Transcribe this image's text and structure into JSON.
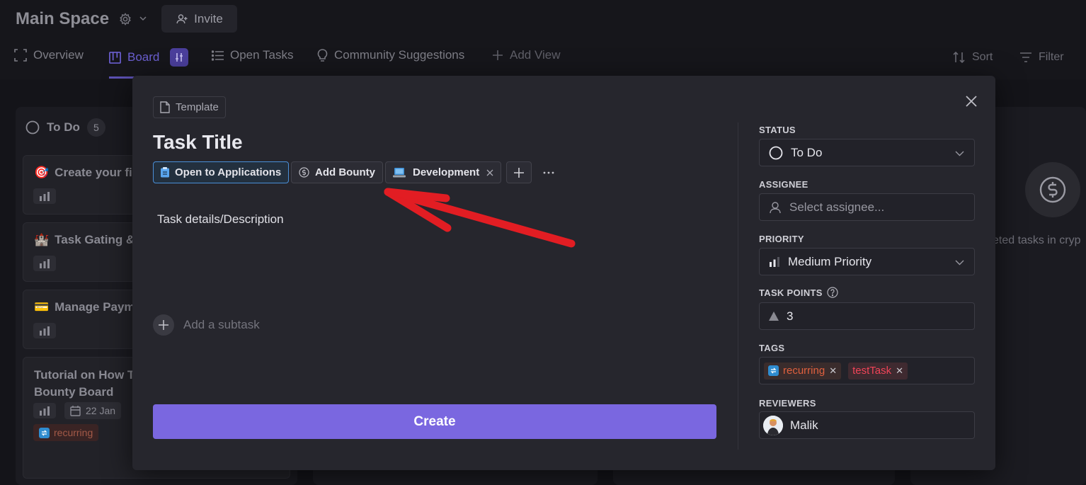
{
  "header": {
    "space_title": "Main Space",
    "invite_label": "Invite"
  },
  "tabs": [
    {
      "label": "Overview"
    },
    {
      "label": "Board"
    },
    {
      "label": "Open Tasks"
    },
    {
      "label": "Community Suggestions"
    },
    {
      "label": "Add View"
    }
  ],
  "controls": {
    "sort": "Sort",
    "filter": "Filter"
  },
  "column": {
    "title": "To Do",
    "count": "5",
    "cards": [
      {
        "emoji": "🎯",
        "title": "Create your fir"
      },
      {
        "emoji": "🏰",
        "title": "Task Gating &"
      },
      {
        "emoji": "💳",
        "title": "Manage Payme"
      },
      {
        "title_line1": "Tutorial on How To",
        "title_line2": "Bounty Board",
        "date": "22 Jan",
        "tag": "recurring"
      }
    ]
  },
  "background_right": {
    "empty_text": "eted tasks in cryp"
  },
  "modal": {
    "template_label": "Template",
    "task_title": "Task Title",
    "chips": {
      "open_to_applications": "Open to Applications",
      "add_bounty": "Add Bounty",
      "development": "Development"
    },
    "description": "Task details/Description",
    "add_subtask": "Add a subtask",
    "create_label": "Create",
    "sidebar": {
      "status_label": "STATUS",
      "status_value": "To Do",
      "assignee_label": "ASSIGNEE",
      "assignee_placeholder": "Select assignee...",
      "priority_label": "PRIORITY",
      "priority_value": "Medium Priority",
      "points_label": "TASK POINTS",
      "points_value": "3",
      "tags_label": "TAGS",
      "tags": [
        "recurring",
        "testTask"
      ],
      "reviewers_label": "REVIEWERS",
      "reviewer_name": "Malik"
    }
  },
  "colors": {
    "accent": "#7a67e0",
    "modal_bg": "#26262d",
    "annotation_arrow": "#e21d23"
  }
}
